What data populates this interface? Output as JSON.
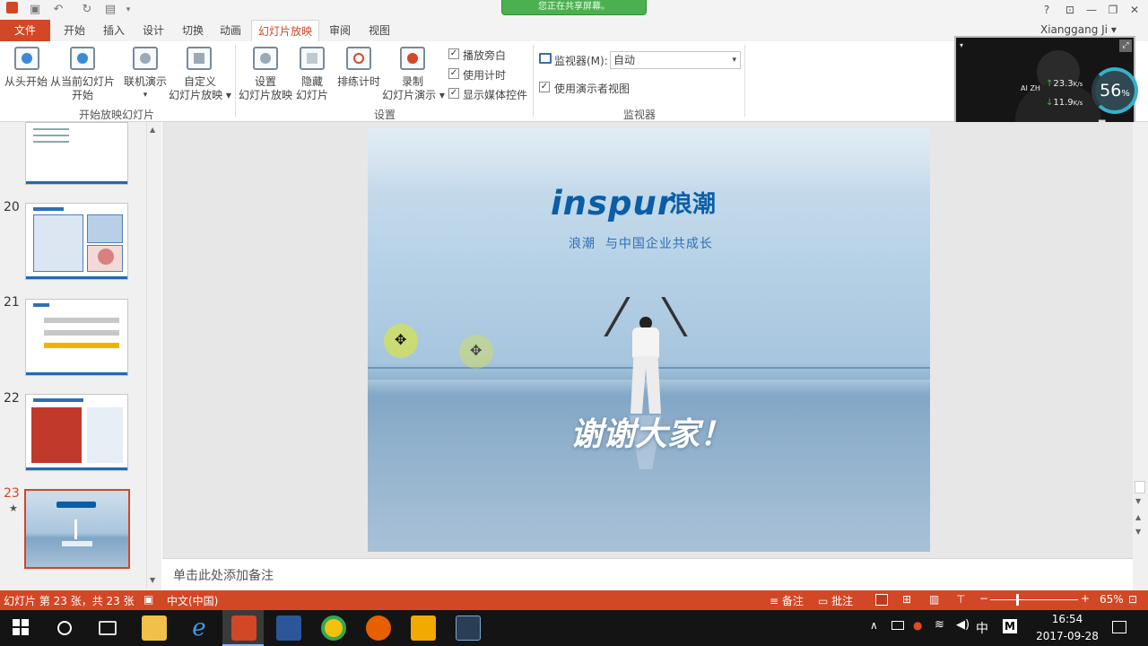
{
  "share_notice": "您正在共享屏幕。",
  "window": {
    "help": "?",
    "user": "Xianggang Ji"
  },
  "tabs": [
    "文件",
    "开始",
    "插入",
    "设计",
    "切换",
    "动画",
    "幻灯片放映",
    "审阅",
    "视图"
  ],
  "ribbon": {
    "btn_from_start": "从头开始",
    "btn_from_current_1": "从当前幻灯片",
    "btn_from_current_2": "开始",
    "btn_online_1": "联机演示",
    "btn_online_2": "",
    "btn_custom_1": "自定义",
    "btn_custom_2": "幻灯片放映",
    "btn_setup_1": "设置",
    "btn_setup_2": "幻灯片放映",
    "btn_hide_1": "隐藏",
    "btn_hide_2": "幻灯片",
    "btn_rehearse": "排练计时",
    "btn_record_1": "录制",
    "btn_record_2": "幻灯片演示",
    "chk_narration": "播放旁白",
    "chk_timings": "使用计时",
    "chk_media": "显示媒体控件",
    "monitor_label": "监视器(M):",
    "monitor_value": "自动",
    "chk_presenter": "使用演示者视图",
    "group_start": "开始放映幻灯片",
    "group_setup": "设置",
    "group_monitor": "监视器"
  },
  "camera": {
    "name": "AI ZH",
    "upload": "23.3",
    "download": "11.9",
    "unit": "K/s",
    "gauge": "56",
    "gauge_unit": "%"
  },
  "slides": [
    {
      "num": "20"
    },
    {
      "num": "21"
    },
    {
      "num": "22"
    },
    {
      "num": "23",
      "star": "★"
    }
  ],
  "slide": {
    "logo": "inspur",
    "logo_cn": "浪潮",
    "tagline": "浪潮  与中国企业共成长",
    "thanks": "谢谢大家！"
  },
  "notes_placeholder": "单击此处添加备注",
  "status": {
    "slide_info": "幻灯片 第 23 张，共 23 张",
    "language": "中文(中国)",
    "notes": "备注",
    "comments": "批注",
    "zoom": "65%",
    "zoom_level": 0.65
  },
  "clock": {
    "time": "16:54",
    "date": "2017-09-28"
  },
  "tray": {
    "ime": "中"
  },
  "colors": {
    "accent": "#d24726",
    "share_green": "#4caf50",
    "inspur_blue": "#0a5ea8"
  }
}
